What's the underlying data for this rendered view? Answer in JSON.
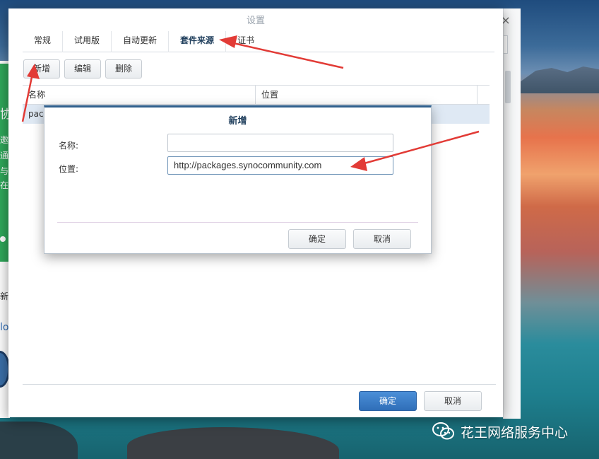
{
  "window": {
    "title": "设置",
    "close_glyph": "×"
  },
  "tabs": [
    {
      "label": "常规",
      "active": false
    },
    {
      "label": "试用版",
      "active": false
    },
    {
      "label": "自动更新",
      "active": false
    },
    {
      "label": "套件来源",
      "active": true
    },
    {
      "label": "证书",
      "active": false
    }
  ],
  "toolbar": {
    "add_label": "新增",
    "edit_label": "编辑",
    "delete_label": "删除"
  },
  "table": {
    "columns": [
      "名称",
      "位置"
    ],
    "rows": [
      {
        "name": "pac",
        "location": ""
      }
    ]
  },
  "footer": {
    "ok_label": "确定",
    "cancel_label": "取消"
  },
  "dialog": {
    "title": "新增",
    "name_label": "名称:",
    "name_value": "",
    "location_label": "位置:",
    "location_value": "http://packages.synocommunity.com",
    "ok_label": "确定",
    "cancel_label": "取消"
  },
  "background_app": {
    "green_chars": [
      "协",
      "邀",
      "通",
      "与",
      "在"
    ],
    "text_1": "新",
    "text_2": "lo"
  },
  "watermark": {
    "text": "花王网络服务中心",
    "icon": "wechat-icon"
  },
  "colors": {
    "arrow": "#e23b36",
    "primary_button": "#2f6eb8",
    "selected_row": "#dfe9f4",
    "dialog_accent": "#2f5f8c"
  }
}
